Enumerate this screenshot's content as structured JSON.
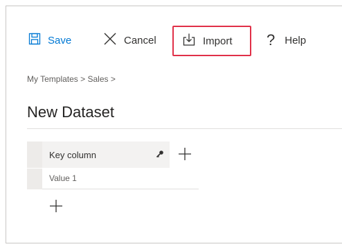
{
  "toolbar": {
    "save_label": "Save",
    "cancel_label": "Cancel",
    "import_label": "Import",
    "help_label": "Help",
    "help_glyph": "?"
  },
  "breadcrumb": "My Templates > Sales >",
  "page_title": "New Dataset",
  "table": {
    "columns": [
      {
        "label": "Key column",
        "is_key": true
      }
    ],
    "rows": [
      [
        "Value 1"
      ]
    ]
  },
  "colors": {
    "accent": "#0078d4",
    "highlight_border": "#e03048"
  },
  "icons": {
    "save": "save-icon",
    "cancel": "close-icon",
    "import": "import-icon",
    "help": "question-icon",
    "key": "key-icon",
    "add_column": "plus-icon",
    "add_row": "plus-icon"
  }
}
